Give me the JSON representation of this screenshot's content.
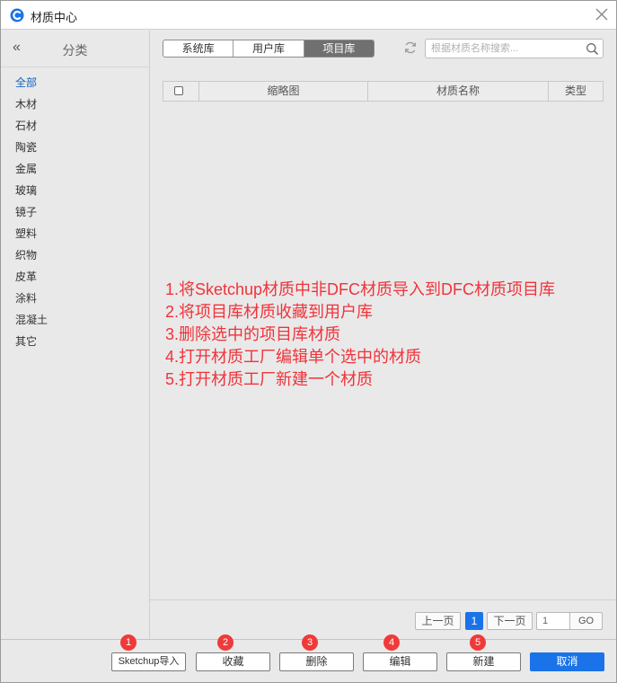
{
  "window": {
    "title": "材质中心"
  },
  "sidebar": {
    "title": "分类",
    "collapse_glyph": "«",
    "categories": [
      "全部",
      "木材",
      "石材",
      "陶瓷",
      "金属",
      "玻璃",
      "镜子",
      "塑料",
      "织物",
      "皮革",
      "涂料",
      "混凝土",
      "其它"
    ],
    "active_index": 0
  },
  "tabs": {
    "items": [
      "系统库",
      "用户库",
      "项目库"
    ],
    "active_index": 2
  },
  "search": {
    "placeholder": "根据材质名称搜索...",
    "value": ""
  },
  "table": {
    "columns": [
      "缩略图",
      "材质名称",
      "类型"
    ],
    "rows": []
  },
  "annotations": [
    "1.将Sketchup材质中非DFC材质导入到DFC材质项目库",
    "2.将项目库材质收藏到用户库",
    "3.删除选中的项目库材质",
    "4.打开材质工厂编辑单个选中的材质",
    "5.打开材质工厂新建一个材质"
  ],
  "pagination": {
    "prev_label": "上一页",
    "current_page": "1",
    "next_label": "下一页",
    "page_input_value": "1",
    "go_label": "GO"
  },
  "footer": {
    "buttons": [
      "Sketchup导入",
      "收藏",
      "删除",
      "编辑",
      "新建"
    ],
    "cancel_label": "取消",
    "badges": [
      "1",
      "2",
      "3",
      "4",
      "5"
    ]
  },
  "colors": {
    "accent": "#1a73e8",
    "annotation": "#f0333a",
    "active_tab": "#707070"
  },
  "icons": {
    "logo": "app-logo-icon",
    "close": "close-icon",
    "refresh": "refresh-icon",
    "search": "search-icon",
    "collapse": "double-chevron-left-icon"
  }
}
